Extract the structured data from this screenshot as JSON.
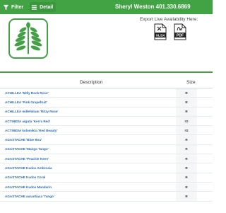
{
  "toolbar": {
    "filter_label": "Filter",
    "detail_label": "Detail",
    "contact": "Sheryl Weston 401.330.6869"
  },
  "export": {
    "label": "Export Live Availability Here:",
    "xlsx_label": "XLSX",
    "pdf_label": "PDF"
  },
  "colors": {
    "brand_green": "#41a344",
    "link_blue": "#2b6cb0"
  },
  "table": {
    "headers": {
      "description": "Description",
      "size": "Size"
    },
    "rows": [
      {
        "name": "ACHILLEA 'Milly Rock Rose'",
        "size": "R"
      },
      {
        "name": "ACHILLEA 'Pink Grapefruit'",
        "size": "R"
      },
      {
        "name": "ACHILLEA millefolium 'Ritzy Rose'",
        "size": "R"
      },
      {
        "name": "ACTINIDIA arguta 'Ken's Red'",
        "size": "#2"
      },
      {
        "name": "ACTINIDIA kolomikta 'Red Beauty'",
        "size": "#2"
      },
      {
        "name": "AGASTACHE 'Blue Boa'",
        "size": "R"
      },
      {
        "name": "AGASTACHE 'Mango Tango'",
        "size": "R"
      },
      {
        "name": "AGASTACHE 'Peachie Keen'",
        "size": "R"
      },
      {
        "name": "AGASTACHE Kudos Ambrosia",
        "size": "R"
      },
      {
        "name": "AGASTACHE Kudos Coral",
        "size": "R"
      },
      {
        "name": "AGASTACHE Kudos Mandarin",
        "size": "R"
      },
      {
        "name": "AGASTACHE aurantiaca 'Tango'",
        "size": "R"
      }
    ]
  }
}
